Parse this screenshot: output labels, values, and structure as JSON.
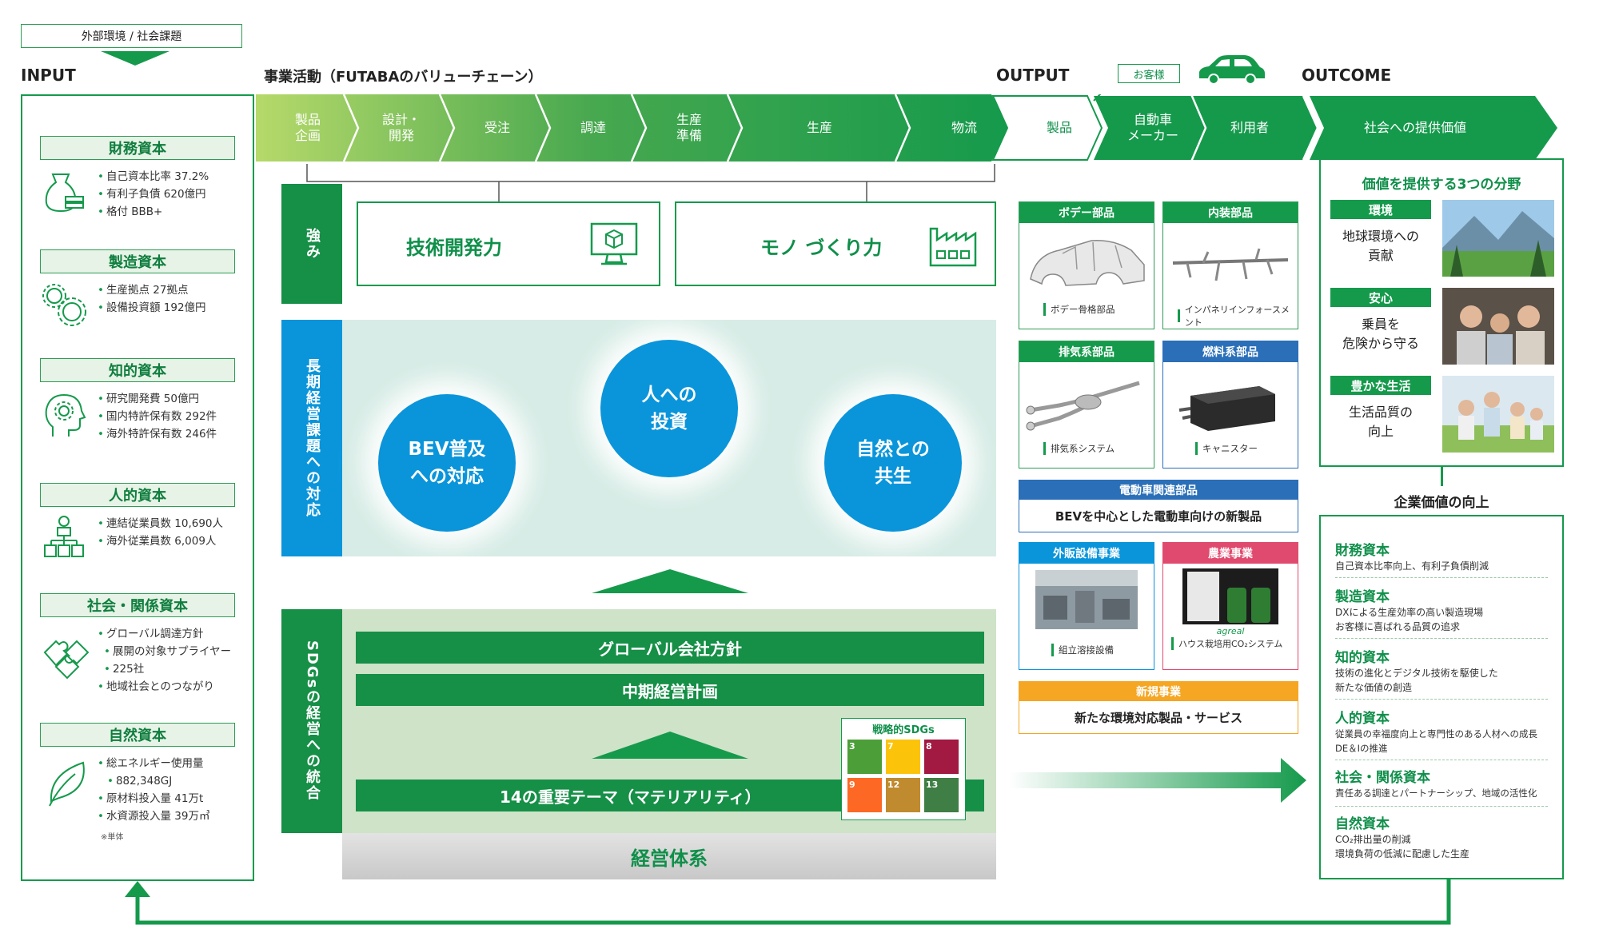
{
  "header": {
    "ext_label": "外部環境 / 社会課題",
    "input": "INPUT",
    "activity": "事業活動（FUTABAのバリューチェーン）",
    "output": "OUTPUT",
    "customer": "お客様",
    "outcome": "OUTCOME"
  },
  "chain": [
    "製品\n企画",
    "設計・\n開発",
    "受注",
    "調達",
    "生産\n準備",
    "生産",
    "物流",
    "製品",
    "自動車\nメーカー",
    "利用者",
    "社会への提供価値"
  ],
  "capitals": [
    {
      "title": "財務資本",
      "icon": "money-bag-icon",
      "items": [
        "自己資本比率 37.2%",
        "有利子負債 620億円",
        "格付 BBB+"
      ]
    },
    {
      "title": "製造資本",
      "icon": "gears-icon",
      "items": [
        "生産拠点 27拠点",
        "設備投資額 192億円"
      ]
    },
    {
      "title": "知的資本",
      "icon": "head-gear-icon",
      "items": [
        "研究開発費 50億円",
        "国内特許保有数 292件",
        "海外特許保有数 246件"
      ]
    },
    {
      "title": "人的資本",
      "icon": "people-org-icon",
      "items": [
        "連結従業員数 10,690人",
        "海外従業員数 6,009人"
      ]
    },
    {
      "title": "社会・関係資本",
      "icon": "puzzle-icon",
      "items": [
        "グローバル調達方針",
        "展開の対象サプライヤー",
        "225社",
        "地域社会とのつながり"
      ]
    },
    {
      "title": "自然資本",
      "icon": "leaf-icon",
      "items": [
        "総エネルギー使用量",
        "882,348GJ",
        "原材料投入量 41万t",
        "水資源投入量 39万㎥"
      ]
    }
  ],
  "capital_note": "※単体",
  "strength": {
    "label": "強み",
    "tech": "技術開発力",
    "mono": "モノ づくり力"
  },
  "long_term": {
    "label": "長期経営課題への対応",
    "c1": "BEV普及\nへの対応",
    "c2": "人への\n投資",
    "c3": "自然との\n共生"
  },
  "sdgs": {
    "label": "SDGsの経営への統合",
    "bar1": "グローバル会社方針",
    "bar2": "中期経営計画",
    "bar3": "14の重要テーマ（マテリアリティ）",
    "strategic": "戦略的SDGs",
    "numbers": [
      "3",
      "7",
      "8",
      "9",
      "12",
      "13"
    ],
    "colors": [
      "#4c9f38",
      "#fcc30b",
      "#a21942",
      "#fd6925",
      "#bf8b2e",
      "#3f7e44"
    ],
    "base": "経営体系"
  },
  "products": {
    "body": {
      "title": "ボデー部品",
      "caption": "ボデー骨格部品"
    },
    "interior": {
      "title": "内装部品",
      "caption": "インパネリインフォースメント"
    },
    "exhaust": {
      "title": "排気系部品",
      "caption": "排気系システム"
    },
    "fuel": {
      "title": "燃料系部品",
      "caption": "キャニスター"
    },
    "ev": {
      "title": "電動車関連部品",
      "body": "BEVを中心とした電動車向けの新製品"
    },
    "external": {
      "title": "外販設備事業",
      "caption": "組立溶接設備"
    },
    "agri": {
      "title": "農業事業",
      "caption": "ハウス栽培用CO₂システム",
      "logo": "agreal"
    },
    "new": {
      "title": "新規事業",
      "body": "新たな環境対応製品・サービス"
    }
  },
  "value": {
    "title": "価値を提供する3つの分野",
    "items": [
      {
        "tag": "環境",
        "text": "地球環境への\n貢献"
      },
      {
        "tag": "安心",
        "text": "乗員を\n危険から守る"
      },
      {
        "tag": "豊かな生活",
        "text": "生活品質の\n向上"
      }
    ]
  },
  "corp": {
    "title": "企業価値の向上",
    "items": [
      {
        "h": "財務資本",
        "d": "自己資本比率向上、有利子負債削減"
      },
      {
        "h": "製造資本",
        "d": "DXによる生産効率の高い製造現場\nお客様に喜ばれる品質の追求"
      },
      {
        "h": "知的資本",
        "d": "技術の進化とデジタル技術を駆使した\n新たな価値の創造"
      },
      {
        "h": "人的資本",
        "d": "従業員の幸福度向上と専門性のある人材への成長\nDE＆Iの推進"
      },
      {
        "h": "社会・関係資本",
        "d": "責任ある調達とパートナーシップ、地域の活性化"
      },
      {
        "h": "自然資本",
        "d": "CO₂排出量の削減\n環境負荷の低減に配慮した生産"
      }
    ]
  }
}
